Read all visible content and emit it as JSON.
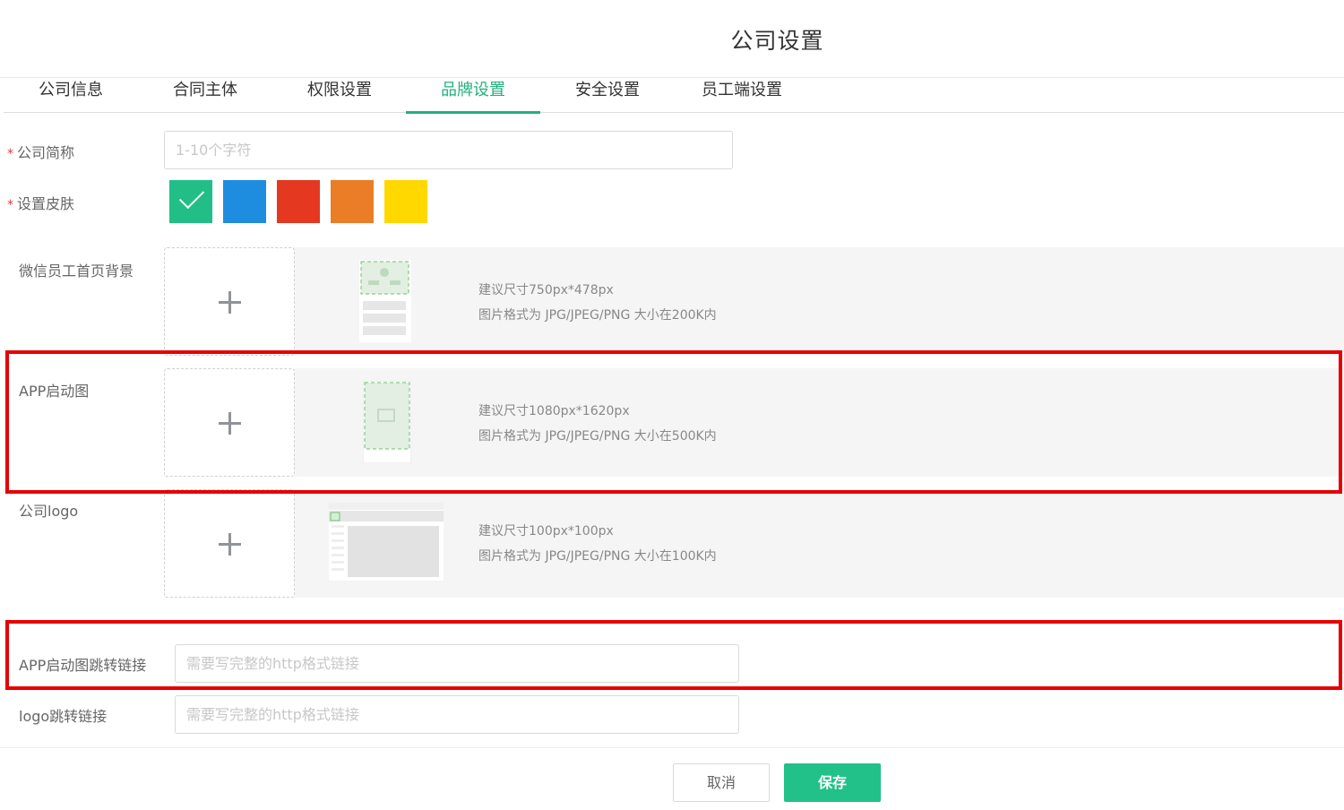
{
  "header": {
    "title": "公司设置"
  },
  "tabs": [
    {
      "label": "公司信息"
    },
    {
      "label": "合同主体"
    },
    {
      "label": "权限设置"
    },
    {
      "label": "品牌设置"
    },
    {
      "label": "安全设置"
    },
    {
      "label": "员工端设置"
    }
  ],
  "active_tab": "品牌设置",
  "form": {
    "company_short_name": {
      "label": "公司简称",
      "required": "*",
      "value": "",
      "placeholder": "1-10个字符"
    },
    "skin": {
      "label": "设置皮肤",
      "required": "*",
      "options": [
        "#21bf87",
        "#1e8de0",
        "#e43820",
        "#ea7d25",
        "#ffd800"
      ],
      "selected": "#21bf87"
    },
    "uploads": {
      "wechat_bg": {
        "label": "微信员工首页背景",
        "hint_size": "建议尺寸750px*478px",
        "hint_format": "图片格式为 JPG/JPEG/PNG 大小在200K内"
      },
      "app_launch": {
        "label": "APP启动图",
        "hint_size": "建议尺寸1080px*1620px",
        "hint_format": "图片格式为 JPG/JPEG/PNG 大小在500K内"
      },
      "company_logo": {
        "label": "公司logo",
        "hint_size": "建议尺寸100px*100px",
        "hint_format": "图片格式为 JPG/JPEG/PNG 大小在100K内"
      }
    },
    "app_launch_link": {
      "label": "APP启动图跳转链接",
      "value": "",
      "placeholder": "需要写完整的http格式链接"
    },
    "logo_link": {
      "label": "logo跳转链接",
      "value": "",
      "placeholder": "需要写完整的http格式链接"
    }
  },
  "footer": {
    "cancel_label": "取消",
    "save_label": "保存"
  },
  "colors": {
    "accent": "#22b07d",
    "highlight": "#e60000",
    "panel_bg": "#f5f5f5"
  }
}
